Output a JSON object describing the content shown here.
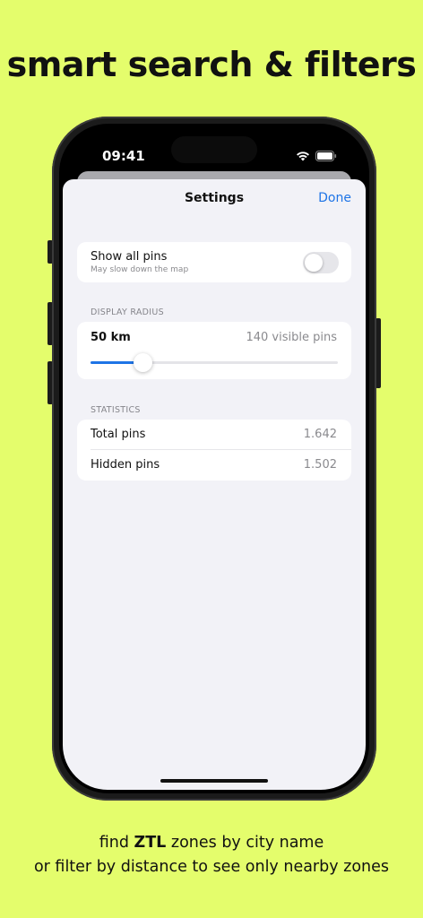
{
  "headline": "smart search & filters",
  "status_bar": {
    "time": "09:41",
    "icons": [
      "wifi-icon",
      "battery-icon"
    ]
  },
  "nav": {
    "title": "Settings",
    "done_label": "Done"
  },
  "show_all_pins": {
    "title": "Show all pins",
    "subtitle": "May slow down the map",
    "enabled": false
  },
  "display_radius": {
    "section_label": "DISPLAY RADIUS",
    "value_label": "50 km",
    "visible_label": "140 visible pins",
    "slider_fraction": 0.21
  },
  "statistics": {
    "section_label": "STATISTICS",
    "rows": [
      {
        "label": "Total pins",
        "value": "1.642"
      },
      {
        "label": "Hidden pins",
        "value": "1.502"
      }
    ]
  },
  "caption": {
    "line1_pre": "find ",
    "line1_bold": "ZTL",
    "line1_post": " zones by city name",
    "line2": "or filter by distance to see only nearby zones"
  },
  "colors": {
    "background": "#e4fd6c",
    "accent": "#1e74e6",
    "sheet": "#f2f2f7"
  }
}
